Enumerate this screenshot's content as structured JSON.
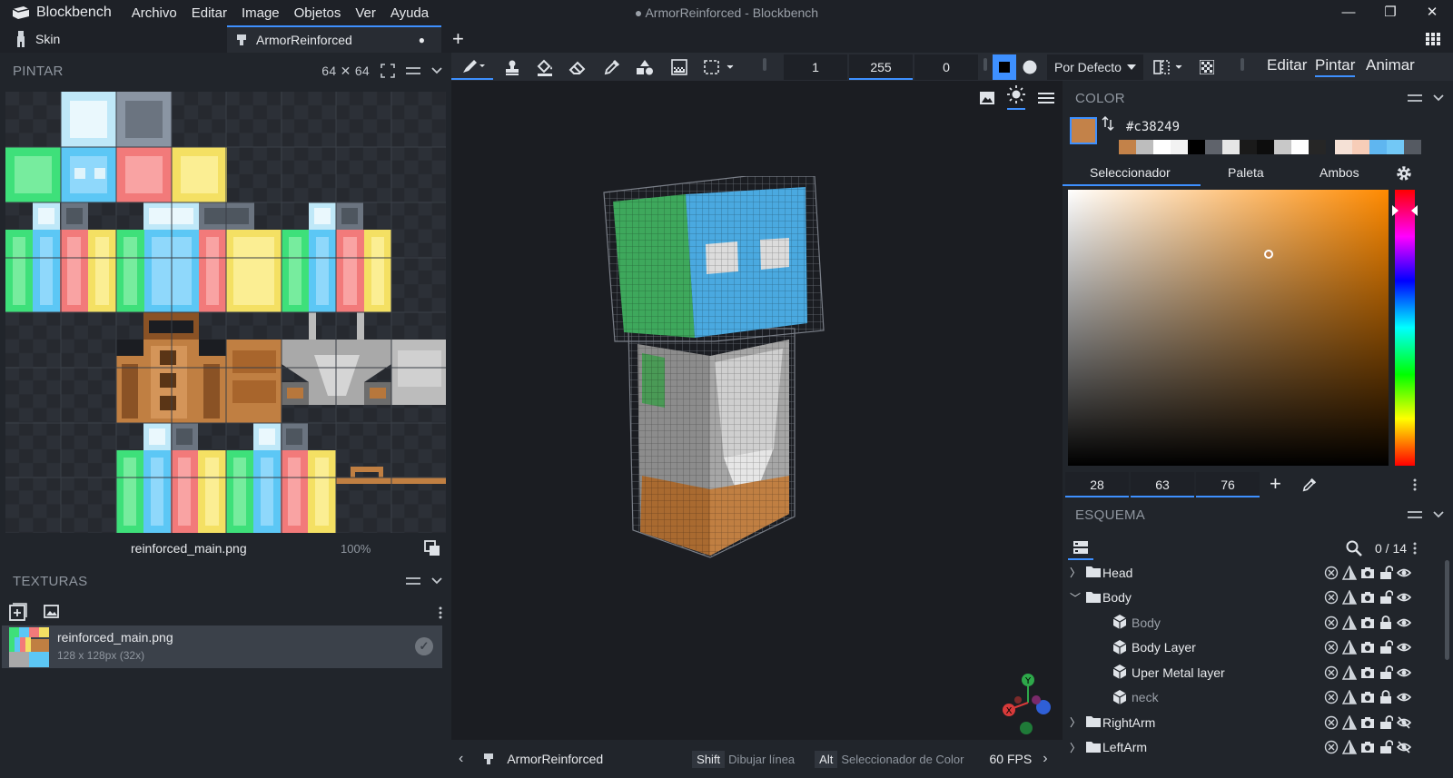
{
  "app": {
    "name": "Blockbench",
    "window_title": "● ArmorReinforced - Blockbench",
    "menu": [
      "Archivo",
      "Editar",
      "Image",
      "Objetos",
      "Ver",
      "Ayuda"
    ]
  },
  "tabs": {
    "skin": "Skin",
    "project": "ArmorReinforced",
    "project_modified": "●",
    "add": "+"
  },
  "paint_panel": {
    "title": "PINTAR",
    "size": "64 ✕ 64",
    "texture_name": "reinforced_main.png",
    "zoom": "100%"
  },
  "textures_panel": {
    "title": "TEXTURAS",
    "item_name": "reinforced_main.png",
    "item_info": "128 x 128px (32x)"
  },
  "toolbar": {
    "brush_size": "1",
    "opacity": "255",
    "softness": "0",
    "blend_mode": "Por Defecto",
    "modes": [
      "Editar",
      "Pintar",
      "Animar"
    ],
    "active_mode": "Pintar"
  },
  "color_panel": {
    "title": "COLOR",
    "hex": "#c38249",
    "main_color": "#c38249",
    "tabs": [
      "Seleccionador",
      "Paleta",
      "Ambos"
    ],
    "active_tab": "Seleccionador",
    "h": "28",
    "s": "63",
    "v": "76",
    "history": [
      "#c38249",
      "#bdbdbd",
      "#ffffff",
      "#f2f2f2",
      "#000000",
      "#5f636b",
      "#e6e6e6",
      "#1a1a1a",
      "#0d0d0d",
      "#c8c8c8",
      "#ffffff",
      "#262626",
      "#f5e1d6",
      "#f7cdb8",
      "#5fb6f0",
      "#72c8f6",
      "#555a62"
    ]
  },
  "outline_panel": {
    "title": "ESQUEMA",
    "count": "0 / 14",
    "items": [
      {
        "label": "Head",
        "type": "group",
        "expanded": false
      },
      {
        "label": "Body",
        "type": "group",
        "expanded": true
      },
      {
        "label": "Body",
        "type": "cube",
        "muted": true
      },
      {
        "label": "Body Layer",
        "type": "cube"
      },
      {
        "label": "Uper Metal layer",
        "type": "cube"
      },
      {
        "label": "neck",
        "type": "cube",
        "muted": true
      },
      {
        "label": "RightArm",
        "type": "group",
        "expanded": false
      },
      {
        "label": "LeftArm",
        "type": "group",
        "expanded": false
      }
    ]
  },
  "status_bar": {
    "project": "ArmorReinforced",
    "key1": "Shift",
    "key1_action": "Dibujar línea",
    "key2": "Alt",
    "key2_action": "Seleccionador de Color",
    "fps": "60 FPS"
  },
  "gizmo": {
    "x": "X",
    "y": "Y"
  }
}
